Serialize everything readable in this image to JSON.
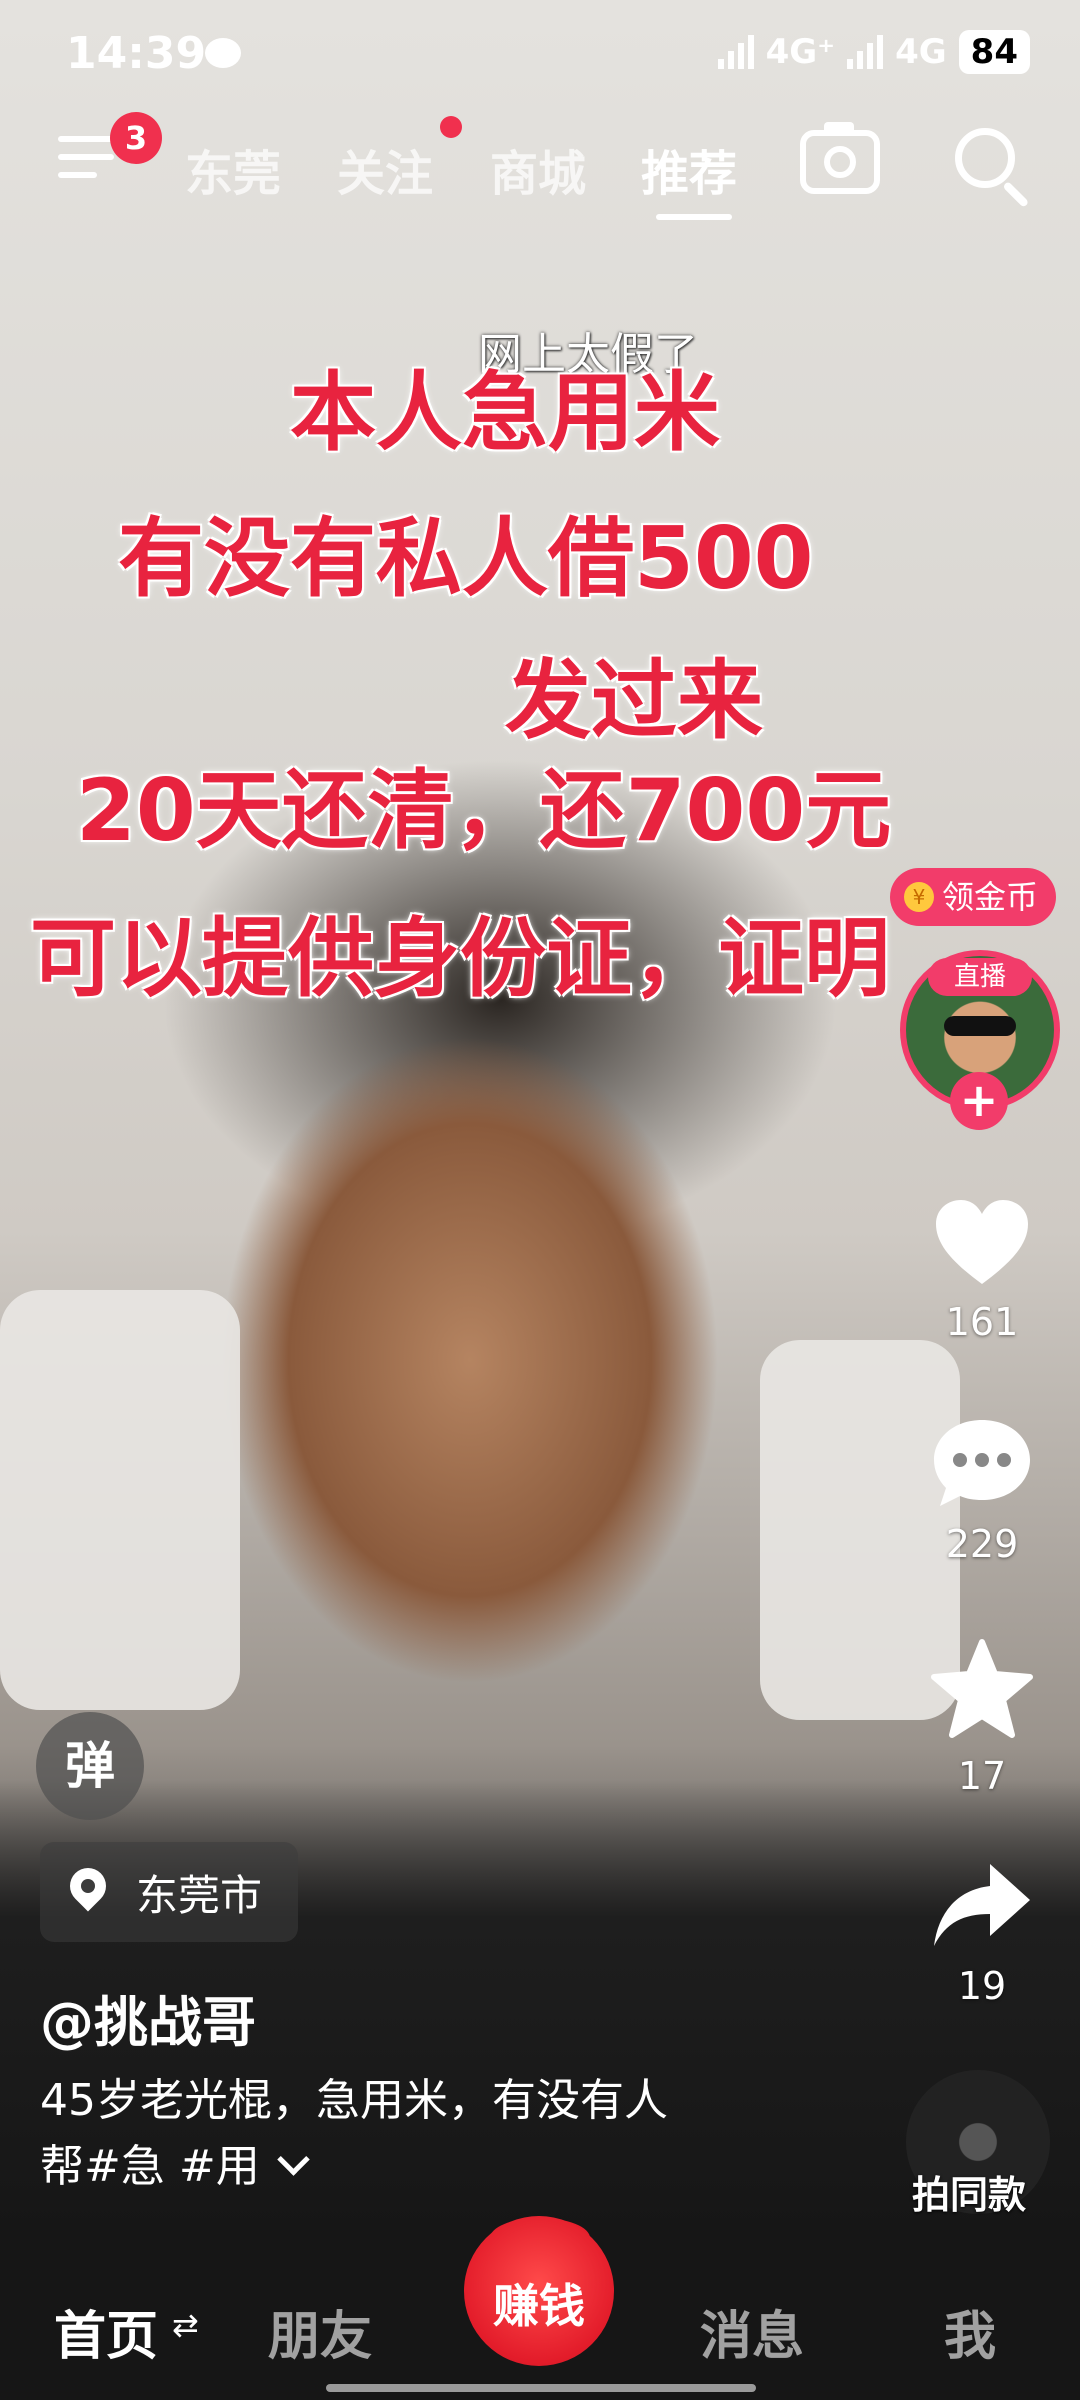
{
  "status": {
    "time": "14:39",
    "network1": "4G⁺",
    "network2": "4G",
    "battery": "84"
  },
  "topnav": {
    "menu_badge": "3",
    "tabs": [
      {
        "label": "东莞"
      },
      {
        "label": "关注"
      },
      {
        "label": "商城"
      },
      {
        "label": "推荐"
      }
    ]
  },
  "video": {
    "captions": [
      "网上太假了",
      "本人急用米",
      "有没有私人借500",
      "发过来",
      "20天还清，还700元",
      "可以提供身份证，证明"
    ]
  },
  "sidebar": {
    "coin_label": "领金币",
    "coin_symbol": "¥",
    "live_label": "直播",
    "follow": "+",
    "likes": "161",
    "comments": "229",
    "favorites": "17",
    "shares": "19"
  },
  "overlay": {
    "danmaku": "弹",
    "location": "东莞市",
    "author": "@挑战哥",
    "desc_line1": "45岁老光棍，急用米，有没有人",
    "desc_line2": "帮#急 #用",
    "music_label": "拍同款"
  },
  "bottom_nav": {
    "home": "首页",
    "friends": "朋友",
    "earn": "赚钱",
    "messages": "消息",
    "me": "我"
  },
  "colors": {
    "accent": "#f23c6a",
    "caption_red": "#e8233f",
    "earn_red": "#e31c2a"
  }
}
